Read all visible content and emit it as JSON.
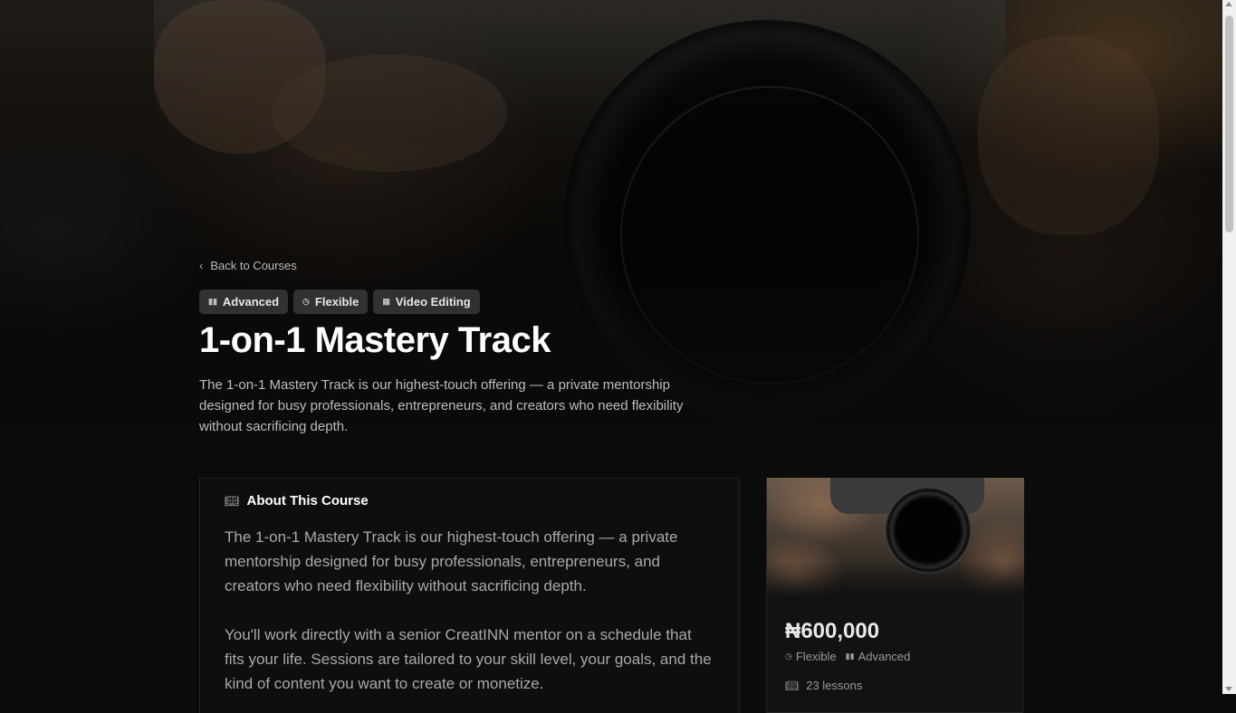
{
  "hero": {
    "back_label": "Back to Courses",
    "tags": [
      {
        "icon": "bar-chart-icon",
        "label": "Advanced"
      },
      {
        "icon": "clock-icon",
        "label": "Flexible"
      },
      {
        "icon": "grid-icon",
        "label": "Video Editing"
      }
    ],
    "title": "1-on-1 Mastery Track",
    "lead": "The 1-on-1 Mastery Track is our highest-touch offering — a private mentorship designed for busy professionals, entrepreneurs, and creators who need flexibility without sacrificing depth."
  },
  "about": {
    "icon": "book-icon",
    "heading": "About This Course",
    "paragraphs": [
      "The 1-on-1 Mastery Track is our highest-touch offering — a private mentorship designed for busy professionals, entrepreneurs, and creators who need flexibility without sacrificing depth.",
      "You'll work directly with a senior CreatINN mentor on a schedule that fits your life. Sessions are tailored to your skill level, your goals, and the kind of content you want to create or monetize."
    ]
  },
  "card": {
    "price": "₦600,000",
    "schedule": "Flexible",
    "level": "Advanced",
    "lessons": "23 lessons"
  }
}
